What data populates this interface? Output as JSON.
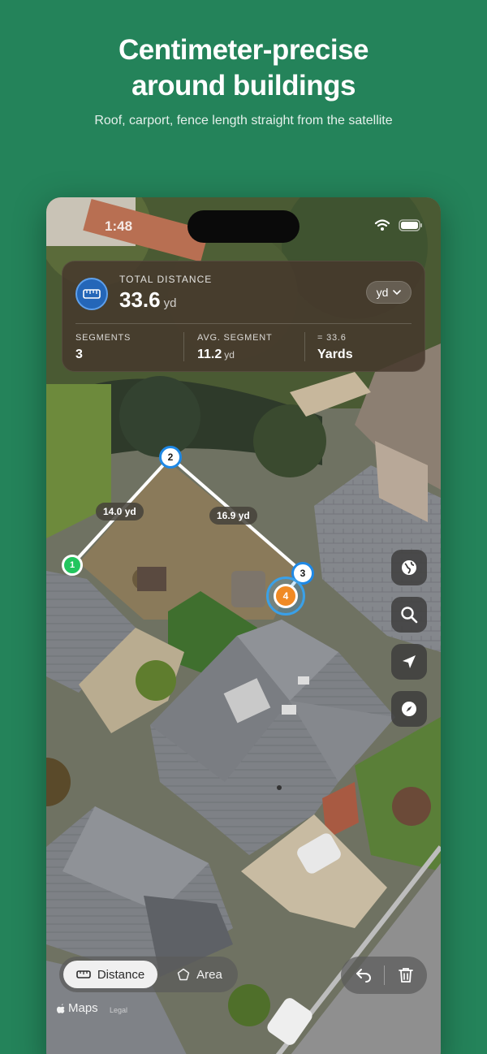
{
  "headline": {
    "title_line1": "Centimeter-precise",
    "title_line2": "around buildings",
    "subtitle": "Roof, carport, fence length straight from the satellite"
  },
  "status_bar": {
    "time": "1:48"
  },
  "summary": {
    "total_label": "TOTAL DISTANCE",
    "total_value": "33.6",
    "total_unit": "yd",
    "unit_selector": "yd",
    "stats": [
      {
        "label": "SEGMENTS",
        "value": "3",
        "unit": ""
      },
      {
        "label": "AVG. SEGMENT",
        "value": "11.2",
        "unit": "yd"
      },
      {
        "label": "= 33.6",
        "value": "Yards",
        "unit": ""
      }
    ]
  },
  "points": [
    {
      "number": "1",
      "color": "#22c55e"
    },
    {
      "number": "2",
      "color": "#ffffff"
    },
    {
      "number": "3",
      "color": "#ffffff"
    },
    {
      "number": "4",
      "color": "#f08a24"
    }
  ],
  "segment_labels": [
    "14.0 yd",
    "16.9 yd"
  ],
  "map_controls": [
    "globe-icon",
    "search-icon",
    "location-arrow-icon",
    "compass-icon"
  ],
  "mode_tabs": {
    "distance": "Distance",
    "area": "Area"
  },
  "actions": [
    "undo-icon",
    "trash-icon"
  ],
  "attribution": {
    "maps": "Maps",
    "legal": "Legal"
  },
  "colors": {
    "background": "#24835a",
    "accent_blue": "#1e88e5",
    "point_start": "#22c55e",
    "point_active": "#f08a24"
  }
}
